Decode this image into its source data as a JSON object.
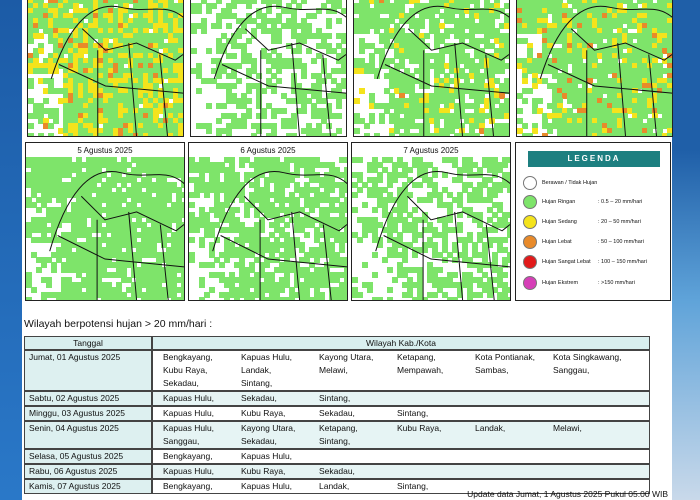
{
  "maps": [
    {
      "title": ""
    },
    {
      "title": ""
    },
    {
      "title": ""
    },
    {
      "title": ""
    },
    {
      "title": "5 Agustus 2025"
    },
    {
      "title": "6 Agustus 2025"
    },
    {
      "title": "7 Agustus 2025"
    }
  ],
  "legend": {
    "title": "LEGENDA",
    "items": [
      {
        "label": "Berawan / Tidak Hujan",
        "range": "",
        "color": "#ffffff"
      },
      {
        "label": "Hujan Ringan",
        "range": ": 0.5 – 20 mm/hari",
        "color": "#7ee46a"
      },
      {
        "label": "Hujan Sedang",
        "range": ": 20 – 50 mm/hari",
        "color": "#f4e31c"
      },
      {
        "label": "Hujan Lebat",
        "range": ": 50 – 100 mm/hari",
        "color": "#e88a2a"
      },
      {
        "label": "Hujan Sangat Lebat",
        "range": ": 100 – 150 mm/hari",
        "color": "#e21a1a"
      },
      {
        "label": "Hujan Ekstrem",
        "range": ": >150 mm/hari",
        "color": "#d63fb7"
      }
    ]
  },
  "heading": "Wilayah berpotensi hujan > 20 mm/hari :",
  "table": {
    "col_date": "Tanggal",
    "col_regions": "Wilayah Kab./Kota",
    "rows": [
      {
        "date": "Jumat, 01 Agustus 2025",
        "regions": [
          "Bengkayang,",
          "Kapuas Hulu,",
          "Kayong Utara,",
          "Ketapang,",
          "Kota Pontianak,",
          "Kota Singkawang,",
          "Kubu Raya,",
          "Landak,",
          "Melawi,",
          "Mempawah,",
          "Sambas,",
          "Sanggau,",
          "Sekadau,",
          "Sintang,"
        ]
      },
      {
        "date": "Sabtu, 02 Agustus 2025",
        "regions": [
          "Kapuas Hulu,",
          "Sekadau,",
          "Sintang,"
        ]
      },
      {
        "date": "Minggu, 03 Agustus 2025",
        "regions": [
          "Kapuas Hulu,",
          "Kubu Raya,",
          "Sekadau,",
          "Sintang,"
        ]
      },
      {
        "date": "Senin, 04 Agustus 2025",
        "regions": [
          "Kapuas Hulu,",
          "Kayong Utara,",
          "Ketapang,",
          "Kubu Raya,",
          "Landak,",
          "Melawi,",
          "Sanggau,",
          "Sekadau,",
          "Sintang,"
        ]
      },
      {
        "date": "Selasa, 05 Agustus 2025",
        "regions": [
          "Bengkayang,",
          "Kapuas Hulu,"
        ]
      },
      {
        "date": "Rabu, 06 Agustus 2025",
        "regions": [
          "Kapuas Hulu,",
          "Kubu Raya,",
          "Sekadau,"
        ]
      },
      {
        "date": "Kamis, 07 Agustus 2025",
        "regions": [
          "Bengkayang,",
          "Kapuas Hulu,",
          "Landak,",
          "Sintang,"
        ]
      }
    ]
  },
  "update_text": "Update data Jumat, 1 Agustus 2025 Pukul 05.00 WIB"
}
